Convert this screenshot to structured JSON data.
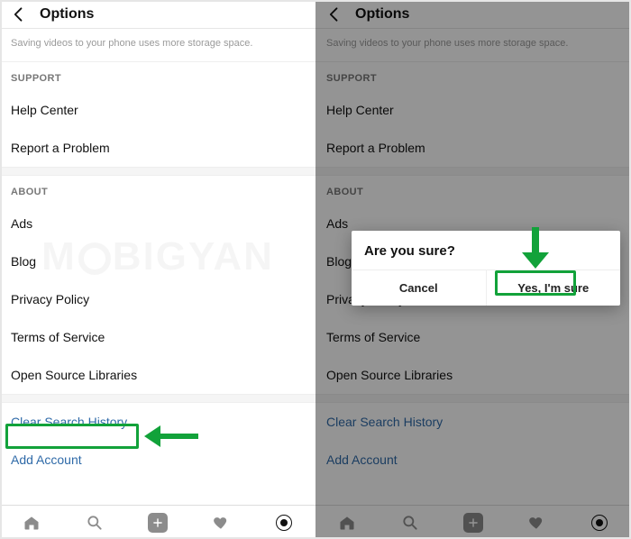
{
  "topbar": {
    "title": "Options"
  },
  "hint": "Saving videos to your phone uses more storage space.",
  "sections": {
    "support_head": "SUPPORT",
    "about_head": "ABOUT"
  },
  "support": {
    "help_center": "Help Center",
    "report_problem": "Report a Problem"
  },
  "about": {
    "ads": "Ads",
    "blog": "Blog",
    "privacy": "Privacy Policy",
    "terms": "Terms of Service",
    "oss": "Open Source Libraries"
  },
  "actions": {
    "clear_search": "Clear Search History",
    "add_account": "Add Account"
  },
  "dialog": {
    "title": "Are you sure?",
    "cancel": "Cancel",
    "confirm": "Yes, I'm sure"
  },
  "icons": {
    "back": "back-arrow-icon",
    "home": "home-icon",
    "search": "search-icon",
    "create": "plus-icon",
    "activity": "heart-icon",
    "profile": "profile-icon"
  },
  "annotation": {
    "color": "#12a23a"
  },
  "watermark": "M  BIGYAN"
}
